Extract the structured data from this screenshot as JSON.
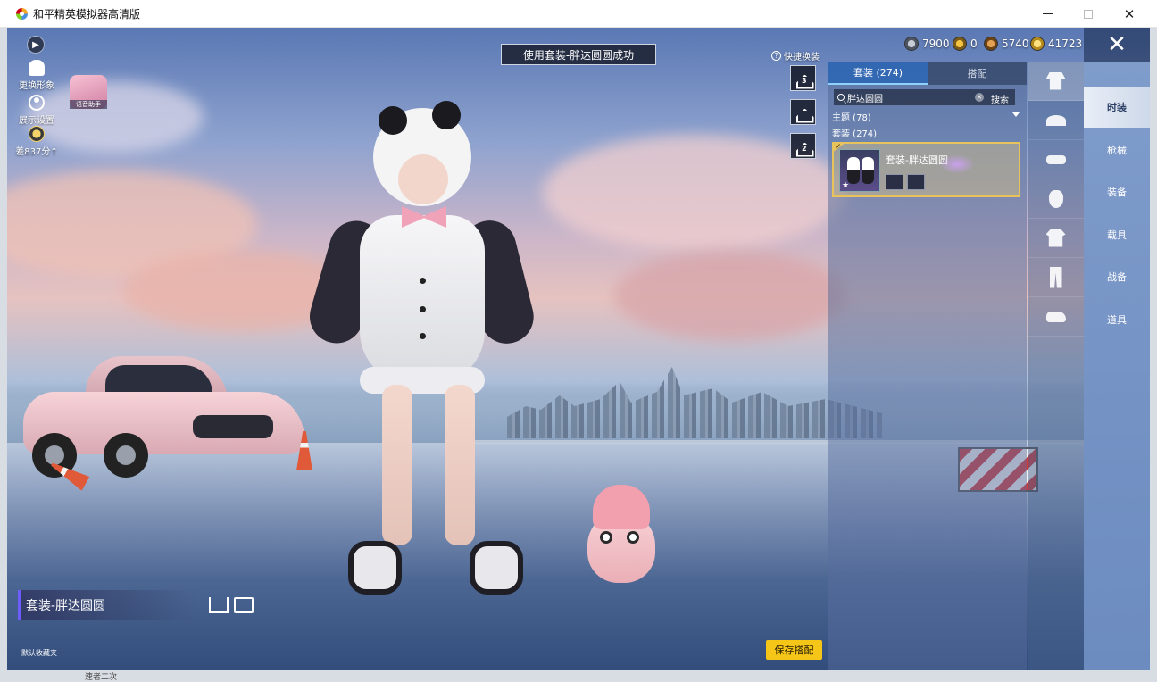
{
  "window": {
    "title": "和平精英模拟器高清版"
  },
  "hud": {
    "toast": "使用套装-胖达圆圆成功",
    "change_avatar_label": "更换形象",
    "display_settings_label": "展示设置",
    "rank_label": "差837分",
    "voice_assistant_label": "语音助手",
    "quick_change_label": "快捷换装",
    "quick_slots": [
      "3",
      "",
      "2"
    ]
  },
  "currencies": [
    {
      "icon": "silver-coin-icon",
      "value": "7900"
    },
    {
      "icon": "token-icon",
      "value": "0"
    },
    {
      "icon": "bronze-coin-icon",
      "value": "5740"
    },
    {
      "icon": "gold-coin-icon",
      "value": "41723"
    }
  ],
  "panel": {
    "tabs": [
      "套装 (274)",
      "搭配"
    ],
    "search_value": "胖达圆圆",
    "search_button": "搜索",
    "theme_filter": "主题 (78)",
    "section_label": "套装 (274)",
    "item": {
      "name": "套装-胖达圆圆",
      "star": "★"
    }
  },
  "right_menu": [
    "时装",
    "枪械",
    "装备",
    "载具",
    "战备",
    "道具"
  ],
  "bottom": {
    "outfit_name": "套装-胖达圆圆",
    "default_favorite": "默认收藏夹",
    "save_button": "保存搭配"
  },
  "background_peek": "速者二次"
}
